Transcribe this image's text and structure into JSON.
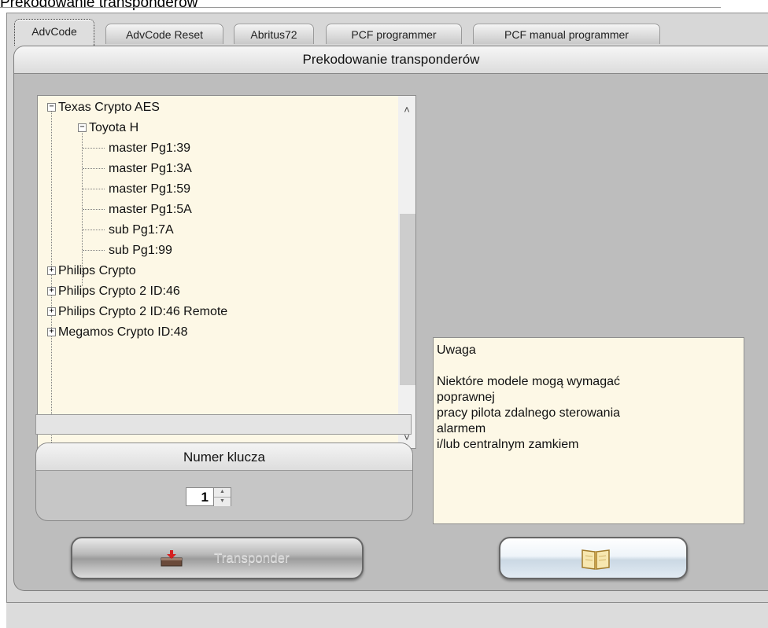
{
  "window": {
    "title": "Prekodowanie transponderów"
  },
  "tabs": [
    {
      "label": "AdvCode",
      "active": true
    },
    {
      "label": "AdvCode Reset",
      "active": false
    },
    {
      "label": "Abritus72",
      "active": false
    },
    {
      "label": "PCF programmer",
      "active": false
    },
    {
      "label": "PCF manual programmer",
      "active": false
    }
  ],
  "panel": {
    "header": "Prekodowanie transponderów"
  },
  "tree": {
    "items": [
      {
        "label": "Texas Crypto AES",
        "toggle": "−"
      },
      {
        "label": "Toyota H",
        "toggle": "−"
      },
      {
        "label": "master Pg1:39"
      },
      {
        "label": "master Pg1:3A"
      },
      {
        "label": "master Pg1:59"
      },
      {
        "label": "master Pg1:5A"
      },
      {
        "label": "sub Pg1:7A"
      },
      {
        "label": "sub Pg1:99"
      },
      {
        "label": "Philips Crypto",
        "toggle": "+"
      },
      {
        "label": "Philips Crypto 2 ID:46",
        "toggle": "+"
      },
      {
        "label": "Philips Crypto 2 ID:46 Remote",
        "toggle": "+"
      },
      {
        "label": "Megamos Crypto ID:48",
        "toggle": "+"
      }
    ],
    "scroll_up_glyph": "˄",
    "scroll_down_glyph": "˅"
  },
  "key_group": {
    "header": "Numer klucza",
    "value": "1",
    "spin_up_glyph": "▲",
    "spin_down_glyph": "▼"
  },
  "buttons": {
    "transponder_label": "Transponder",
    "transponder_icon": "chip-reader-icon",
    "book_icon": "open-book-icon"
  },
  "notice": {
    "lines": [
      "Uwaga",
      "",
      "Niektóre modele mogą wymagać",
      "poprawnej",
      "pracy pilota zdalnego sterowania",
      "alarmem",
      "i/lub centralnym zamkiem"
    ]
  },
  "colors": {
    "frame": "#d7d7d7",
    "panel": "#bdbdbd",
    "list_bg": "#fdf8e6"
  }
}
